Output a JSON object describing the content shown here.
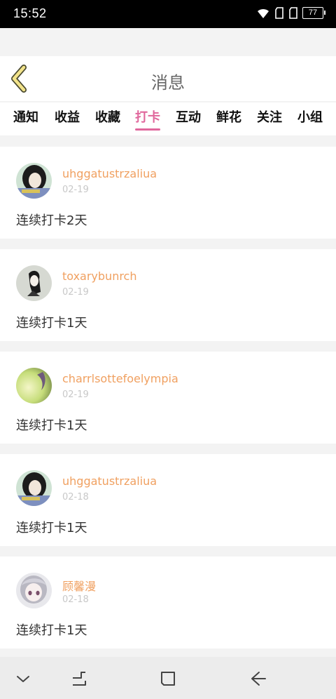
{
  "status_bar": {
    "time": "15:52",
    "battery": "77"
  },
  "header": {
    "title": "消息"
  },
  "tabs": [
    {
      "label": "通知"
    },
    {
      "label": "收益"
    },
    {
      "label": "收藏"
    },
    {
      "label": "打卡",
      "active": true
    },
    {
      "label": "互动"
    },
    {
      "label": "鲜花"
    },
    {
      "label": "关注"
    },
    {
      "label": "小组"
    }
  ],
  "items": [
    {
      "name": "uhggatustrzaliua",
      "date": "02-19",
      "message": "连续打卡2天"
    },
    {
      "name": "toxarybunrch",
      "date": "02-19",
      "message": "连续打卡1天"
    },
    {
      "name": "charrlsottefoelympia",
      "date": "02-19",
      "message": "连续打卡1天"
    },
    {
      "name": "uhggatustrzaliua",
      "date": "02-18",
      "message": "连续打卡1天"
    },
    {
      "name": "顾馨漫",
      "date": "02-18",
      "message": "连续打卡1天"
    }
  ],
  "icons": {
    "back": "chevron-left-icon",
    "nav_down": "chevron-down-icon",
    "nav_recent": "recent-apps-icon",
    "nav_home": "home-icon",
    "nav_back": "back-arrow-icon"
  },
  "colors": {
    "accent": "#e0679c",
    "username": "#f0a060",
    "back_icon": "#f2e38a"
  }
}
